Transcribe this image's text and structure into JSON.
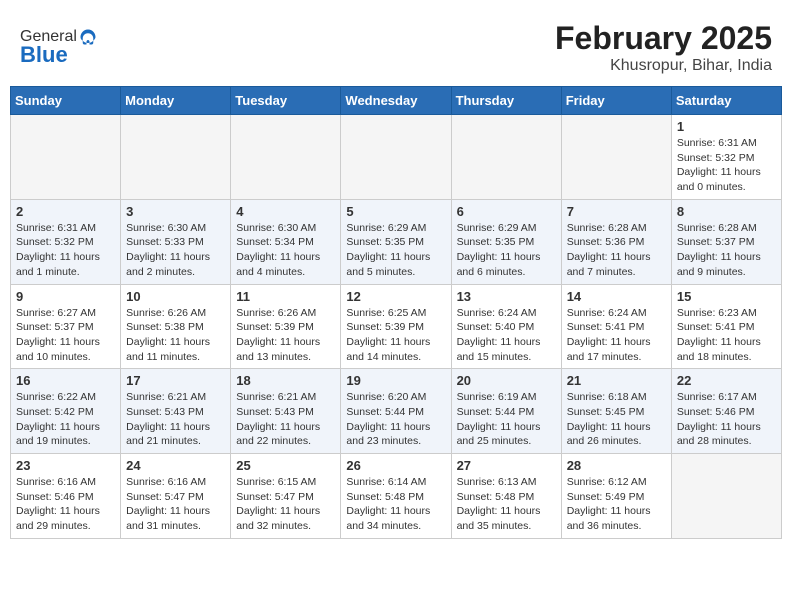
{
  "header": {
    "logo_line1": "General",
    "logo_line2": "Blue",
    "month_year": "February 2025",
    "location": "Khusropur, Bihar, India"
  },
  "days_of_week": [
    "Sunday",
    "Monday",
    "Tuesday",
    "Wednesday",
    "Thursday",
    "Friday",
    "Saturday"
  ],
  "weeks": [
    [
      {
        "day": "",
        "info": ""
      },
      {
        "day": "",
        "info": ""
      },
      {
        "day": "",
        "info": ""
      },
      {
        "day": "",
        "info": ""
      },
      {
        "day": "",
        "info": ""
      },
      {
        "day": "",
        "info": ""
      },
      {
        "day": "1",
        "info": "Sunrise: 6:31 AM\nSunset: 5:32 PM\nDaylight: 11 hours\nand 0 minutes."
      }
    ],
    [
      {
        "day": "2",
        "info": "Sunrise: 6:31 AM\nSunset: 5:32 PM\nDaylight: 11 hours\nand 1 minute."
      },
      {
        "day": "3",
        "info": "Sunrise: 6:30 AM\nSunset: 5:33 PM\nDaylight: 11 hours\nand 2 minutes."
      },
      {
        "day": "4",
        "info": "Sunrise: 6:30 AM\nSunset: 5:34 PM\nDaylight: 11 hours\nand 4 minutes."
      },
      {
        "day": "5",
        "info": "Sunrise: 6:29 AM\nSunset: 5:35 PM\nDaylight: 11 hours\nand 5 minutes."
      },
      {
        "day": "6",
        "info": "Sunrise: 6:29 AM\nSunset: 5:35 PM\nDaylight: 11 hours\nand 6 minutes."
      },
      {
        "day": "7",
        "info": "Sunrise: 6:28 AM\nSunset: 5:36 PM\nDaylight: 11 hours\nand 7 minutes."
      },
      {
        "day": "8",
        "info": "Sunrise: 6:28 AM\nSunset: 5:37 PM\nDaylight: 11 hours\nand 9 minutes."
      }
    ],
    [
      {
        "day": "9",
        "info": "Sunrise: 6:27 AM\nSunset: 5:37 PM\nDaylight: 11 hours\nand 10 minutes."
      },
      {
        "day": "10",
        "info": "Sunrise: 6:26 AM\nSunset: 5:38 PM\nDaylight: 11 hours\nand 11 minutes."
      },
      {
        "day": "11",
        "info": "Sunrise: 6:26 AM\nSunset: 5:39 PM\nDaylight: 11 hours\nand 13 minutes."
      },
      {
        "day": "12",
        "info": "Sunrise: 6:25 AM\nSunset: 5:39 PM\nDaylight: 11 hours\nand 14 minutes."
      },
      {
        "day": "13",
        "info": "Sunrise: 6:24 AM\nSunset: 5:40 PM\nDaylight: 11 hours\nand 15 minutes."
      },
      {
        "day": "14",
        "info": "Sunrise: 6:24 AM\nSunset: 5:41 PM\nDaylight: 11 hours\nand 17 minutes."
      },
      {
        "day": "15",
        "info": "Sunrise: 6:23 AM\nSunset: 5:41 PM\nDaylight: 11 hours\nand 18 minutes."
      }
    ],
    [
      {
        "day": "16",
        "info": "Sunrise: 6:22 AM\nSunset: 5:42 PM\nDaylight: 11 hours\nand 19 minutes."
      },
      {
        "day": "17",
        "info": "Sunrise: 6:21 AM\nSunset: 5:43 PM\nDaylight: 11 hours\nand 21 minutes."
      },
      {
        "day": "18",
        "info": "Sunrise: 6:21 AM\nSunset: 5:43 PM\nDaylight: 11 hours\nand 22 minutes."
      },
      {
        "day": "19",
        "info": "Sunrise: 6:20 AM\nSunset: 5:44 PM\nDaylight: 11 hours\nand 23 minutes."
      },
      {
        "day": "20",
        "info": "Sunrise: 6:19 AM\nSunset: 5:44 PM\nDaylight: 11 hours\nand 25 minutes."
      },
      {
        "day": "21",
        "info": "Sunrise: 6:18 AM\nSunset: 5:45 PM\nDaylight: 11 hours\nand 26 minutes."
      },
      {
        "day": "22",
        "info": "Sunrise: 6:17 AM\nSunset: 5:46 PM\nDaylight: 11 hours\nand 28 minutes."
      }
    ],
    [
      {
        "day": "23",
        "info": "Sunrise: 6:16 AM\nSunset: 5:46 PM\nDaylight: 11 hours\nand 29 minutes."
      },
      {
        "day": "24",
        "info": "Sunrise: 6:16 AM\nSunset: 5:47 PM\nDaylight: 11 hours\nand 31 minutes."
      },
      {
        "day": "25",
        "info": "Sunrise: 6:15 AM\nSunset: 5:47 PM\nDaylight: 11 hours\nand 32 minutes."
      },
      {
        "day": "26",
        "info": "Sunrise: 6:14 AM\nSunset: 5:48 PM\nDaylight: 11 hours\nand 34 minutes."
      },
      {
        "day": "27",
        "info": "Sunrise: 6:13 AM\nSunset: 5:48 PM\nDaylight: 11 hours\nand 35 minutes."
      },
      {
        "day": "28",
        "info": "Sunrise: 6:12 AM\nSunset: 5:49 PM\nDaylight: 11 hours\nand 36 minutes."
      },
      {
        "day": "",
        "info": ""
      }
    ]
  ]
}
